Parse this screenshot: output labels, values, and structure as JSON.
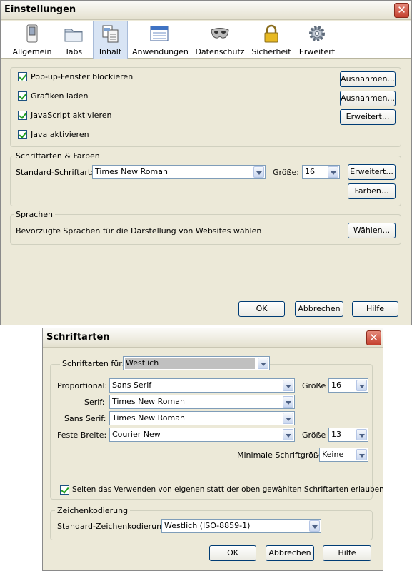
{
  "prefs": {
    "title": "Einstellungen",
    "close": "✕",
    "tabs": [
      {
        "label": "Allgemein"
      },
      {
        "label": "Tabs"
      },
      {
        "label": "Inhalt"
      },
      {
        "label": "Anwendungen"
      },
      {
        "label": "Datenschutz"
      },
      {
        "label": "Sicherheit"
      },
      {
        "label": "Erweitert"
      }
    ],
    "content": {
      "popup_label": "Pop-up-Fenster blockieren",
      "images_label": "Grafiken laden",
      "js_label": "JavaScript aktivieren",
      "java_label": "Java aktivieren",
      "exceptions_btn": "Ausnahmen...",
      "advanced_btn": "Erweitert..."
    },
    "fonts": {
      "group_label": "Schriftarten & Farben",
      "default_font_label": "Standard-Schriftart:",
      "default_font_value": "Times New Roman",
      "size_label": "Größe:",
      "size_value": "16",
      "advanced_btn": "Erweitert...",
      "colors_btn": "Farben..."
    },
    "languages": {
      "group_label": "Sprachen",
      "description": "Bevorzugte Sprachen für die Darstellung von Websites wählen",
      "choose_btn": "Wählen..."
    },
    "ok": "OK",
    "cancel": "Abbrechen",
    "help": "Hilfe"
  },
  "fontsdlg": {
    "title": "Schriftarten",
    "close": "✕",
    "fonts_for_label": "Schriftarten für:",
    "fonts_for_value": "Westlich",
    "proportional_label": "Proportional:",
    "proportional_value": "Sans Serif",
    "size_label": "Größe",
    "proportional_size": "16",
    "serif_label": "Serif:",
    "serif_value": "Times New Roman",
    "sans_label": "Sans Serif:",
    "sans_value": "Times New Roman",
    "mono_label": "Feste Breite:",
    "mono_value": "Courier New",
    "mono_size": "13",
    "min_size_label": "Minimale Schriftgröße:",
    "min_size_value": "Keine",
    "allow_label": "Seiten das Verwenden von eigenen statt der oben gewählten Schriftarten erlauben",
    "encoding_group": "Zeichenkodierung",
    "encoding_label": "Standard-Zeichenkodierung:",
    "encoding_value": "Westlich (ISO-8859-1)",
    "ok": "OK",
    "cancel": "Abbrechen",
    "help": "Hilfe"
  }
}
